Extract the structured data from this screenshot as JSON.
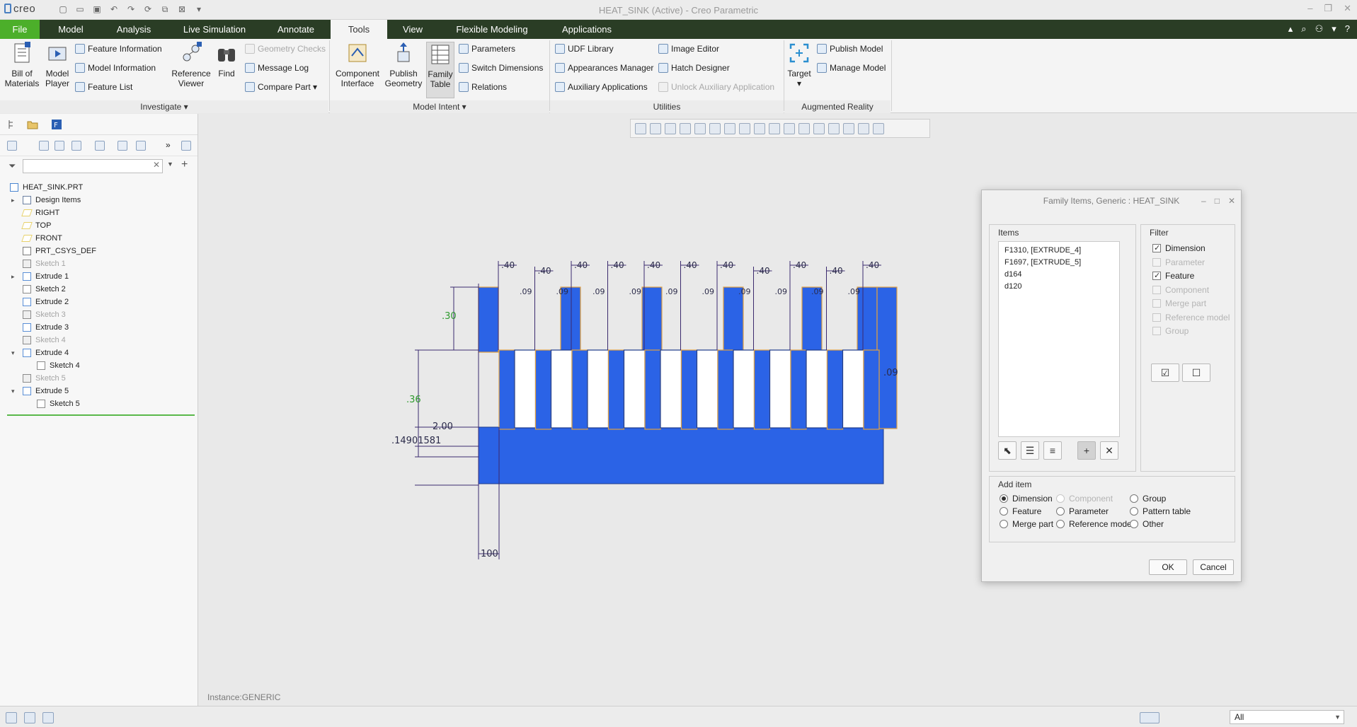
{
  "window": {
    "app_logo": "creo",
    "title": "HEAT_SINK (Active) - Creo Parametric"
  },
  "tabs": [
    "File",
    "Model",
    "Analysis",
    "Live Simulation",
    "Annotate",
    "Tools",
    "View",
    "Flexible Modeling",
    "Applications"
  ],
  "active_tab": "Tools",
  "ribbon": {
    "investigate": {
      "label": "Investigate",
      "bill_of_materials": "Bill of\nMaterials",
      "model_player": "Model\nPlayer",
      "feature_information": "Feature Information",
      "model_information": "Model Information",
      "feature_list": "Feature List",
      "reference_viewer": "Reference\nViewer",
      "find": "Find",
      "geometry_checks": "Geometry Checks",
      "message_log": "Message Log",
      "compare_part": "Compare Part"
    },
    "model_intent": {
      "label": "Model Intent",
      "component_interface": "Component\nInterface",
      "publish_geometry": "Publish\nGeometry",
      "family_table": "Family\nTable",
      "parameters": "Parameters",
      "switch_dimensions": "Switch Dimensions",
      "relations": "Relations"
    },
    "utilities": {
      "label": "Utilities",
      "udf_library": "UDF Library",
      "appearances_manager": "Appearances Manager",
      "auxiliary_applications": "Auxiliary Applications",
      "image_editor": "Image Editor",
      "hatch_designer": "Hatch Designer",
      "unlock_auxiliary_application": "Unlock Auxiliary Application"
    },
    "augmented_reality": {
      "label": "Augmented Reality",
      "target": "Target",
      "publish_model": "Publish Model",
      "manage_model": "Manage Model"
    }
  },
  "model_tree": [
    {
      "label": "HEAT_SINK.PRT",
      "icon": "part-icon",
      "indent": 0,
      "expander": "",
      "dim": false
    },
    {
      "label": "Design Items",
      "icon": "design-items-icon",
      "indent": 1,
      "expander": "▸",
      "dim": false
    },
    {
      "label": "RIGHT",
      "icon": "datum-plane-icon",
      "indent": 1,
      "expander": "",
      "dim": false
    },
    {
      "label": "TOP",
      "icon": "datum-plane-icon",
      "indent": 1,
      "expander": "",
      "dim": false
    },
    {
      "label": "FRONT",
      "icon": "datum-plane-icon",
      "indent": 1,
      "expander": "",
      "dim": false
    },
    {
      "label": "PRT_CSYS_DEF",
      "icon": "csys-icon",
      "indent": 1,
      "expander": "",
      "dim": false
    },
    {
      "label": "Sketch 1",
      "icon": "sketch-icon",
      "indent": 1,
      "expander": "",
      "dim": true
    },
    {
      "label": "Extrude 1",
      "icon": "extrude-icon",
      "indent": 1,
      "expander": "▸",
      "dim": false
    },
    {
      "label": "Sketch 2",
      "icon": "sketch-icon",
      "indent": 1,
      "expander": "",
      "dim": false
    },
    {
      "label": "Extrude 2",
      "icon": "extrude-icon",
      "indent": 1,
      "expander": "",
      "dim": false
    },
    {
      "label": "Sketch 3",
      "icon": "sketch-icon",
      "indent": 1,
      "expander": "",
      "dim": true
    },
    {
      "label": "Extrude 3",
      "icon": "extrude-icon",
      "indent": 1,
      "expander": "",
      "dim": false
    },
    {
      "label": "Sketch 4",
      "icon": "sketch-icon",
      "indent": 1,
      "expander": "",
      "dim": true
    },
    {
      "label": "Extrude 4",
      "icon": "extrude-icon",
      "indent": 1,
      "expander": "▾",
      "dim": false
    },
    {
      "label": "Sketch 4",
      "icon": "sketch-icon",
      "indent": 2,
      "expander": "",
      "dim": false
    },
    {
      "label": "Sketch 5",
      "icon": "sketch-icon",
      "indent": 1,
      "expander": "",
      "dim": true
    },
    {
      "label": "Extrude 5",
      "icon": "extrude-icon",
      "indent": 1,
      "expander": "▾",
      "dim": false
    },
    {
      "label": "Sketch 5",
      "icon": "sketch-icon",
      "indent": 2,
      "expander": "",
      "dim": false
    }
  ],
  "graphics": {
    "instance_label": "Instance:GENERIC",
    "model_color": "#2b63e6",
    "dims": {
      "fin_width": ".40",
      "fin_gap": ".09",
      "fin_height": ".30",
      "total_height": ".36",
      "base": "2.00",
      "base_value": ".14901581",
      "length": "100",
      "fin_side": ".09",
      "fin_extra": ".40"
    }
  },
  "dialog": {
    "title": "Family Items,  Generic : HEAT_SINK",
    "items_label": "Items",
    "items": [
      "F1310, [EXTRUDE_4]",
      "F1697, [EXTRUDE_5]",
      "d164",
      "d120"
    ],
    "filter_label": "Filter",
    "filters": [
      {
        "label": "Dimension",
        "checked": true,
        "enabled": true
      },
      {
        "label": "Parameter",
        "checked": false,
        "enabled": false
      },
      {
        "label": "Feature",
        "checked": true,
        "enabled": true
      },
      {
        "label": "Component",
        "checked": false,
        "enabled": false
      },
      {
        "label": "Merge part",
        "checked": false,
        "enabled": false
      },
      {
        "label": "Reference model",
        "checked": false,
        "enabled": false
      },
      {
        "label": "Group",
        "checked": false,
        "enabled": false
      }
    ],
    "add_item_label": "Add item",
    "add_items": [
      {
        "label": "Dimension",
        "selected": true,
        "enabled": true
      },
      {
        "label": "Component",
        "selected": false,
        "enabled": false
      },
      {
        "label": "Group",
        "selected": false,
        "enabled": true
      },
      {
        "label": "Feature",
        "selected": false,
        "enabled": true
      },
      {
        "label": "Parameter",
        "selected": false,
        "enabled": true
      },
      {
        "label": "Pattern table",
        "selected": false,
        "enabled": true
      },
      {
        "label": "Merge part",
        "selected": false,
        "enabled": true
      },
      {
        "label": "Reference model",
        "selected": false,
        "enabled": true
      },
      {
        "label": "Other",
        "selected": false,
        "enabled": true
      }
    ],
    "ok": "OK",
    "cancel": "Cancel"
  },
  "statusbar": {
    "filter_value": "All"
  }
}
